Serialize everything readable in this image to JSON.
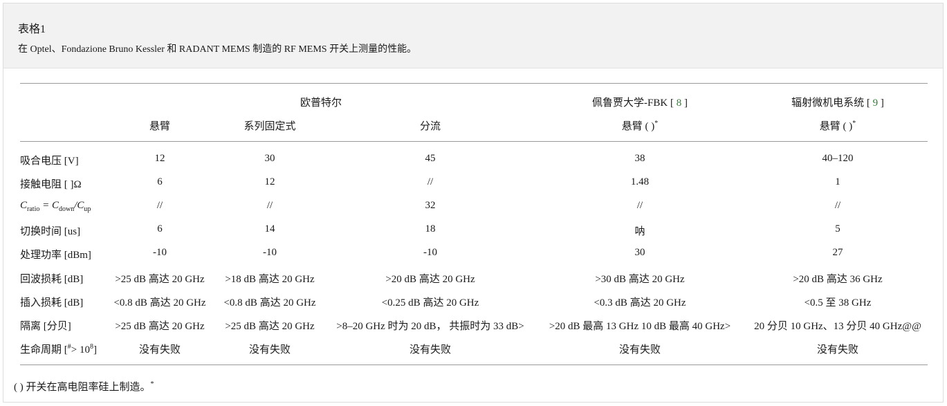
{
  "caption": {
    "title": "表格1",
    "text": "在 Optel、Fondazione Bruno Kessler 和 RADANT MEMS 制造的 RF MEMS 开关上测量的性能。"
  },
  "table": {
    "groups": {
      "optel": "欧普特尔",
      "fbk_prefix": "佩鲁贾大学-FBK [",
      "fbk_ref": "8",
      "fbk_suffix": "]",
      "radant_prefix": "辐射微机电系统 [",
      "radant_ref": "9",
      "radant_suffix": "]"
    },
    "subheaders": {
      "cantilever": "悬臂",
      "series_fixed": "系列固定式",
      "shunt": "分流",
      "fbk_cantilever": "悬臂 ( )",
      "fbk_mark": "*",
      "radant_cantilever": "悬臂 ( )",
      "radant_mark": "*"
    },
    "rows": [
      {
        "label": "吸合电压 [V]",
        "values": [
          "12",
          "30",
          "45",
          "38",
          "40–120"
        ]
      },
      {
        "label": "接触电阻 [ ]Ω",
        "values": [
          "6",
          "12",
          "//",
          "1.48",
          "1"
        ]
      },
      {
        "label_parts": {
          "c": "C",
          "ratio": "ratio",
          "eq": " = C",
          "down": "down",
          "slash": "/C",
          "up": "up"
        },
        "values": [
          "//",
          "//",
          "32",
          "//",
          "//"
        ]
      },
      {
        "label": "切换时间 [us]",
        "values": [
          "6",
          "14",
          "18",
          "呐",
          "5"
        ]
      },
      {
        "label": "处理功率 [dBm]",
        "values": [
          "-10",
          "-10",
          "-10",
          "30",
          "27"
        ]
      },
      {
        "label": "回波损耗 [dB]",
        "values": [
          ">25 dB 高达 20 GHz",
          ">18 dB 高达 20 GHz",
          ">20 dB 高达 20 GHz",
          ">30 dB 高达 20 GHz",
          ">20 dB 高达 36 GHz"
        ]
      },
      {
        "label": "插入损耗 [dB]",
        "values": [
          "<0.8 dB 高达 20 GHz",
          "<0.8 dB 高达 20 GHz",
          "<0.25 dB 高达 20 GHz",
          "<0.3 dB 高达 20 GHz",
          "<0.5 至 38 GHz"
        ]
      },
      {
        "label": "隔离 [分贝]",
        "values": [
          ">25 dB 高达 20 GHz",
          ">25 dB 高达 20 GHz",
          ">8–20 GHz 时为 20 dB， 共振时为 33 dB>",
          ">20 dB 最高 13 GHz 10 dB 最高 40 GHz>",
          "20 分贝  10 GHz、13 分贝  40 GHz@@"
        ]
      },
      {
        "label_parts": {
          "pre": "生命周期 [",
          "sup1": "#",
          "mid": "> 10",
          "sup2": "8",
          "post": "]"
        },
        "values": [
          "没有失败",
          "没有失败",
          "没有失败",
          "没有失败",
          "没有失败"
        ]
      }
    ]
  },
  "footnote": {
    "text": "( ) 开关在高电阻率硅上制造。",
    "mark": "*"
  }
}
